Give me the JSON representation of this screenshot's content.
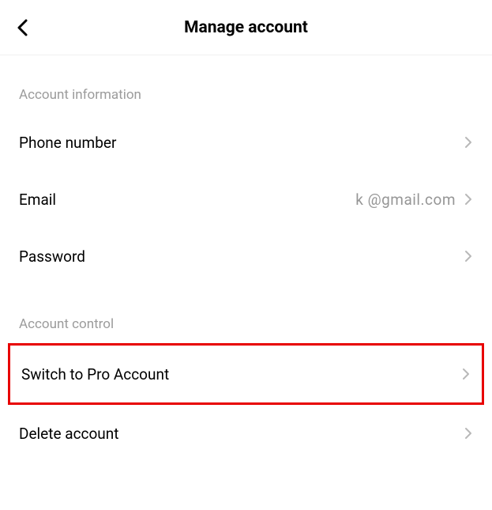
{
  "header": {
    "title": "Manage account"
  },
  "sections": {
    "accountInformation": {
      "title": "Account information",
      "phoneNumber": {
        "label": "Phone number"
      },
      "email": {
        "label": "Email",
        "value": "k   @gmail.com"
      },
      "password": {
        "label": "Password"
      }
    },
    "accountControl": {
      "title": "Account control",
      "switchToPro": {
        "label": "Switch to Pro Account"
      },
      "deleteAccount": {
        "label": "Delete account"
      }
    }
  }
}
